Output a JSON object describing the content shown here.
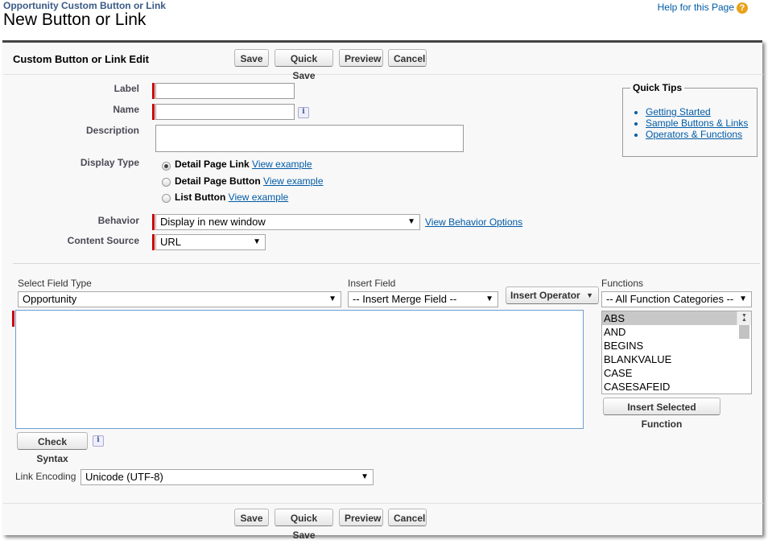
{
  "header": {
    "super_title": "Opportunity Custom Button or Link",
    "title": "New Button or Link",
    "help_label": "Help for this Page",
    "help_icon": "?"
  },
  "edit": {
    "section_title": "Custom Button or Link Edit",
    "buttons": {
      "save": "Save",
      "quick_save": "Quick Save",
      "preview": "Preview",
      "cancel": "Cancel"
    }
  },
  "form": {
    "label_label": "Label",
    "label_value": "",
    "name_label": "Name",
    "name_value": "",
    "description_label": "Description",
    "description_value": "",
    "display_type_label": "Display Type",
    "display_types": [
      {
        "label": "Detail Page Link",
        "link": "View example",
        "selected": true
      },
      {
        "label": "Detail Page Button",
        "link": "View example",
        "selected": false
      },
      {
        "label": "List Button",
        "link": "View example",
        "selected": false
      }
    ],
    "behavior_label": "Behavior",
    "behavior_value": "Display in new window",
    "behavior_link": "View Behavior Options",
    "content_source_label": "Content Source",
    "content_source_value": "URL"
  },
  "quick_tips": {
    "title": "Quick Tips",
    "items": [
      "Getting Started",
      "Sample Buttons & Links",
      "Operators & Functions"
    ]
  },
  "formula": {
    "field_type_label": "Select Field Type",
    "field_type_value": "Opportunity",
    "insert_field_label": "Insert Field",
    "insert_field_value": "-- Insert Merge Field --",
    "insert_operator": "Insert Operator",
    "functions_label": "Functions",
    "function_category": "-- All Function Categories --",
    "functions": [
      "ABS",
      "AND",
      "BEGINS",
      "BLANKVALUE",
      "CASE",
      "CASESAFEID"
    ],
    "insert_function": "Insert Selected Function",
    "check_syntax": "Check Syntax",
    "link_encoding_label": "Link Encoding",
    "link_encoding_value": "Unicode (UTF-8)"
  },
  "colors": {
    "required": "#cc0000",
    "link": "#015ba7",
    "help_icon": "#e8a21b"
  }
}
